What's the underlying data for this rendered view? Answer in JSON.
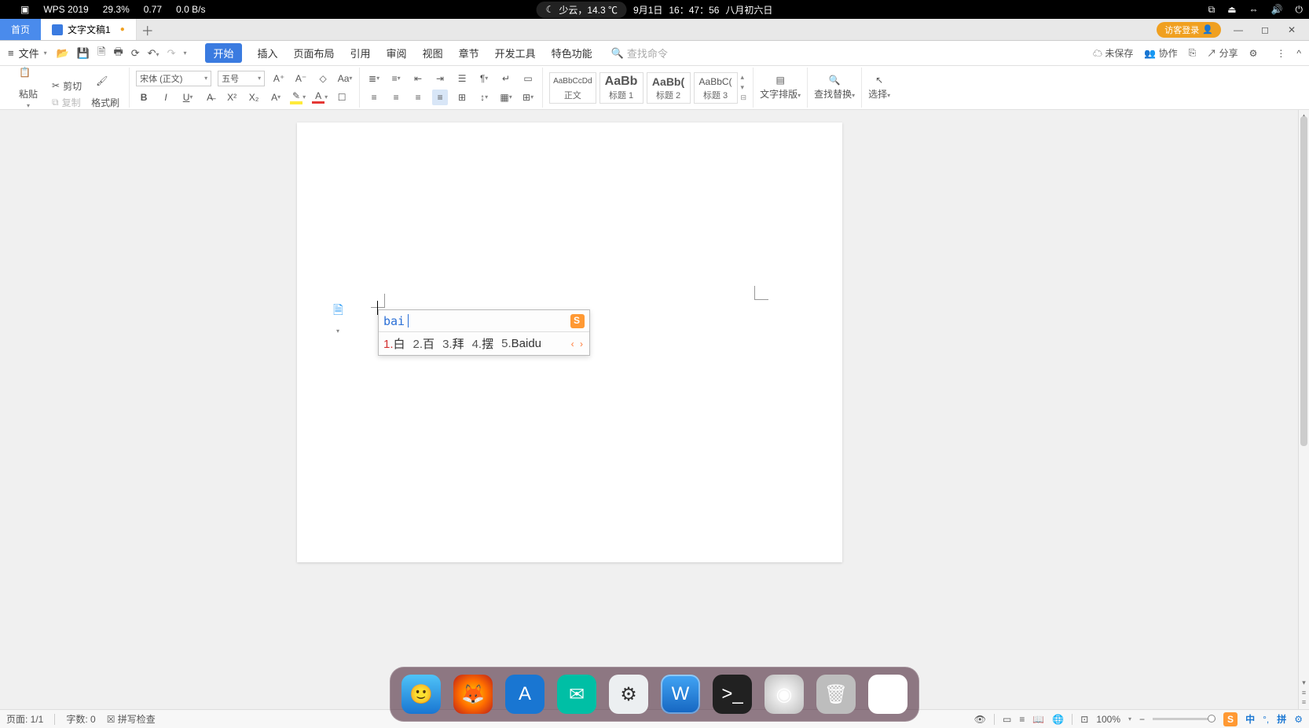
{
  "menubar": {
    "app_name": "WPS 2019",
    "stat1": "29.3%",
    "stat2": "0.77",
    "stat3": "0.0 B/s",
    "weather": "少云，14.3 ℃",
    "date": "9月1日",
    "time": "16：47：56",
    "lunar": "八月初六日"
  },
  "tabs": {
    "home": "首页",
    "document": "文字文稿1",
    "login": "访客登录"
  },
  "menu": {
    "file": "文件",
    "tabs": [
      "开始",
      "插入",
      "页面布局",
      "引用",
      "审阅",
      "视图",
      "章节",
      "开发工具",
      "特色功能"
    ],
    "search_placeholder": "查找命令",
    "unsaved": "未保存",
    "collab": "协作",
    "share": "分享"
  },
  "ribbon": {
    "paste": "粘贴",
    "cut": "剪切",
    "copy": "复制",
    "format_painter": "格式刷",
    "font_name": "宋体 (正文)",
    "font_size": "五号",
    "styles": [
      {
        "preview": "AaBbCcDd",
        "label": "正文"
      },
      {
        "preview": "AaBb",
        "label": "标题 1"
      },
      {
        "preview": "AaBb(",
        "label": "标题 2"
      },
      {
        "preview": "AaBbC(",
        "label": "标题 3"
      }
    ],
    "text_layout": "文字排版",
    "find_replace": "查找替换",
    "select": "选择"
  },
  "ime": {
    "typed": "bai",
    "candidates": [
      {
        "n": "1.",
        "w": "白"
      },
      {
        "n": "2.",
        "w": "百"
      },
      {
        "n": "3.",
        "w": "拜"
      },
      {
        "n": "4.",
        "w": "摆"
      },
      {
        "n": "5.",
        "w": "Baidu"
      }
    ]
  },
  "status": {
    "page": "页面: 1/1",
    "words": "字数: 0",
    "spellcheck": "拼写检查",
    "zoom": "100%",
    "ime_lang": "中",
    "ime_mode": "拼"
  }
}
